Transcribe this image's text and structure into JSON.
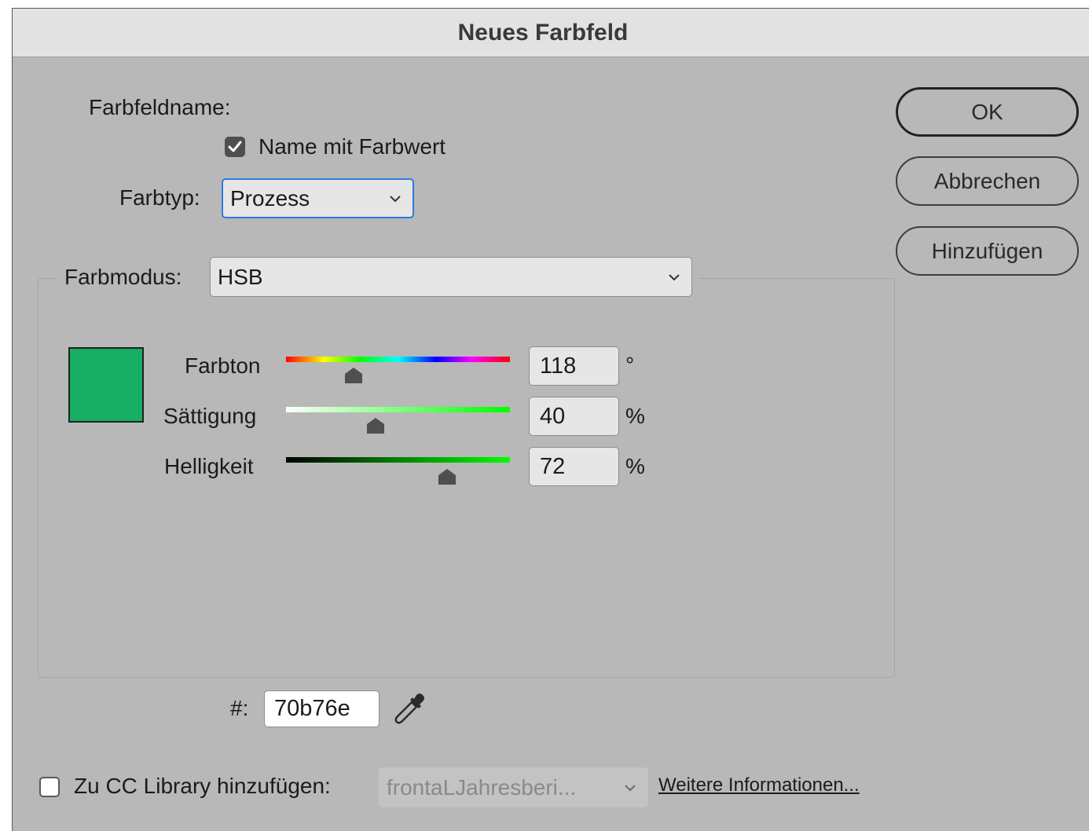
{
  "dialog": {
    "title": "Neues Farbfeld"
  },
  "swatch_name": {
    "label": "Farbfeldname:",
    "name_with_value_label": "Name mit Farbwert",
    "name_with_value_checked": true
  },
  "color_type": {
    "label": "Farbtyp:",
    "value": "Prozess"
  },
  "color_mode": {
    "label": "Farbmodus:",
    "value": "HSB"
  },
  "preview": {
    "color": "#17ad62"
  },
  "sliders": [
    {
      "label": "Farbton",
      "value": "118",
      "unit": "°",
      "level": 0.3
    },
    {
      "label": "Sättigung",
      "value": "40",
      "unit": "%",
      "level": 0.4
    },
    {
      "label": "Helligkeit",
      "value": "72",
      "unit": "%",
      "level": 0.72
    }
  ],
  "hex": {
    "label": "#:",
    "value": "70b76e"
  },
  "buttons": {
    "ok": "OK",
    "cancel": "Abbrechen",
    "add": "Hinzufügen"
  },
  "cc_library": {
    "label": "Zu CC Library hinzufügen:",
    "checked": false,
    "library": "frontaLJahresberi...",
    "more_info": "Weitere Informationen..."
  },
  "icons": {
    "eyedropper": "eyedropper-icon",
    "chevron": "chevron-down-icon"
  },
  "colors": {
    "dialog_bg": "#b8b8b8",
    "titlebar_bg": "#e2e2e2",
    "focus_ring": "#2d7be0"
  }
}
